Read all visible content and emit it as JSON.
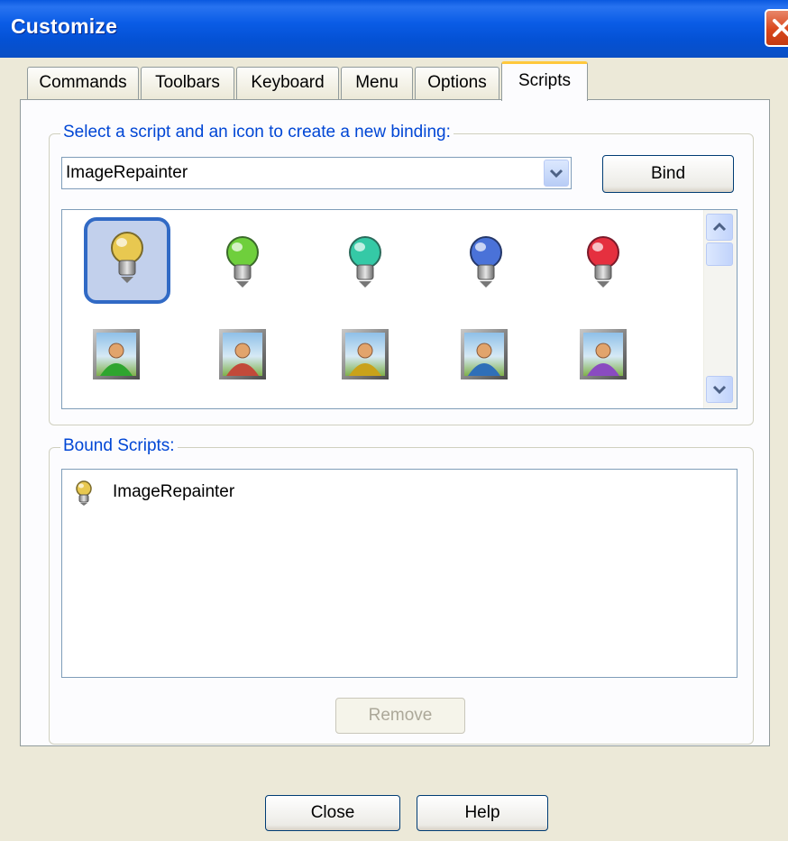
{
  "window": {
    "title": "Customize"
  },
  "tabs": [
    {
      "label": "Commands",
      "active": false
    },
    {
      "label": "Toolbars",
      "active": false
    },
    {
      "label": "Keyboard",
      "active": false
    },
    {
      "label": "Menu",
      "active": false
    },
    {
      "label": "Options",
      "active": false
    },
    {
      "label": "Scripts",
      "active": true
    }
  ],
  "binding_group": {
    "legend": "Select a script and an icon to create a new binding:",
    "script_select": {
      "value": "ImageRepainter"
    },
    "bind_label": "Bind",
    "icons": [
      {
        "name": "bulb-yellow-icon",
        "color": "#e8c850",
        "selected": true
      },
      {
        "name": "bulb-green-icon",
        "color": "#6fcf3c"
      },
      {
        "name": "bulb-teal-icon",
        "color": "#35c9a6"
      },
      {
        "name": "bulb-blue-icon",
        "color": "#4a72d8"
      },
      {
        "name": "bulb-red-icon",
        "color": "#e5303f"
      },
      {
        "name": "person-green-icon",
        "color": "#2fa52f"
      },
      {
        "name": "person-red-icon",
        "color": "#c24a3a"
      },
      {
        "name": "person-gold-icon",
        "color": "#c9a21a"
      },
      {
        "name": "person-blue-icon",
        "color": "#2f6fb8"
      },
      {
        "name": "person-purple-icon",
        "color": "#8a4bc0"
      }
    ]
  },
  "bound_group": {
    "legend": "Bound Scripts:",
    "items": [
      {
        "label": "ImageRepainter",
        "icon": "bulb-yellow-icon"
      }
    ],
    "remove_label": "Remove"
  },
  "footer": {
    "close_label": "Close",
    "help_label": "Help"
  }
}
